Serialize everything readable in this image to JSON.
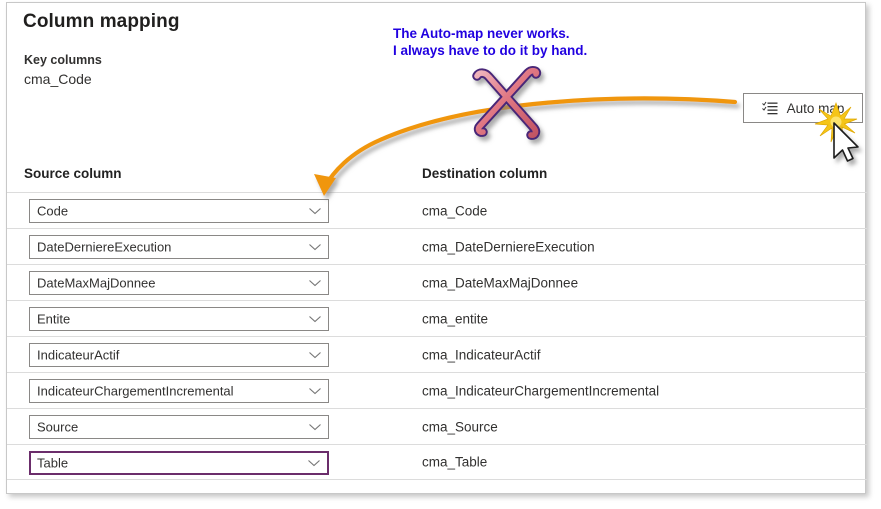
{
  "page": {
    "title": "Column mapping",
    "key_columns_label": "Key columns",
    "key_columns_value": "cma_Code"
  },
  "toolbar": {
    "auto_map_label": "Auto map",
    "auto_map_icon": "bulleted-list-check-icon"
  },
  "table": {
    "source_header": "Source column",
    "destination_header": "Destination column",
    "rows": [
      {
        "source": "Code",
        "destination": "cma_Code",
        "focused": false
      },
      {
        "source": "DateDerniereExecution",
        "destination": "cma_DateDerniereExecution",
        "focused": false
      },
      {
        "source": "DateMaxMajDonnee",
        "destination": "cma_DateMaxMajDonnee",
        "focused": false
      },
      {
        "source": "Entite",
        "destination": "cma_entite",
        "focused": false
      },
      {
        "source": "IndicateurActif",
        "destination": "cma_IndicateurActif",
        "focused": false
      },
      {
        "source": "IndicateurChargementIncremental",
        "destination": "cma_IndicateurChargementIncremental",
        "focused": false
      },
      {
        "source": "Source",
        "destination": "cma_Source",
        "focused": false
      },
      {
        "source": "Table",
        "destination": "cma_Table",
        "focused": true
      }
    ]
  },
  "annotations": {
    "note_line1": "The Auto-map never works.",
    "note_line2": "I always have to do it by hand.",
    "note_color": "#2000e0",
    "arrow_color": "#f0960a",
    "cross_color": "#e8808c",
    "cross_outline_color": "#4a2878",
    "starburst_color": "#f5c518",
    "focus_border_color": "#6b2d6b"
  }
}
